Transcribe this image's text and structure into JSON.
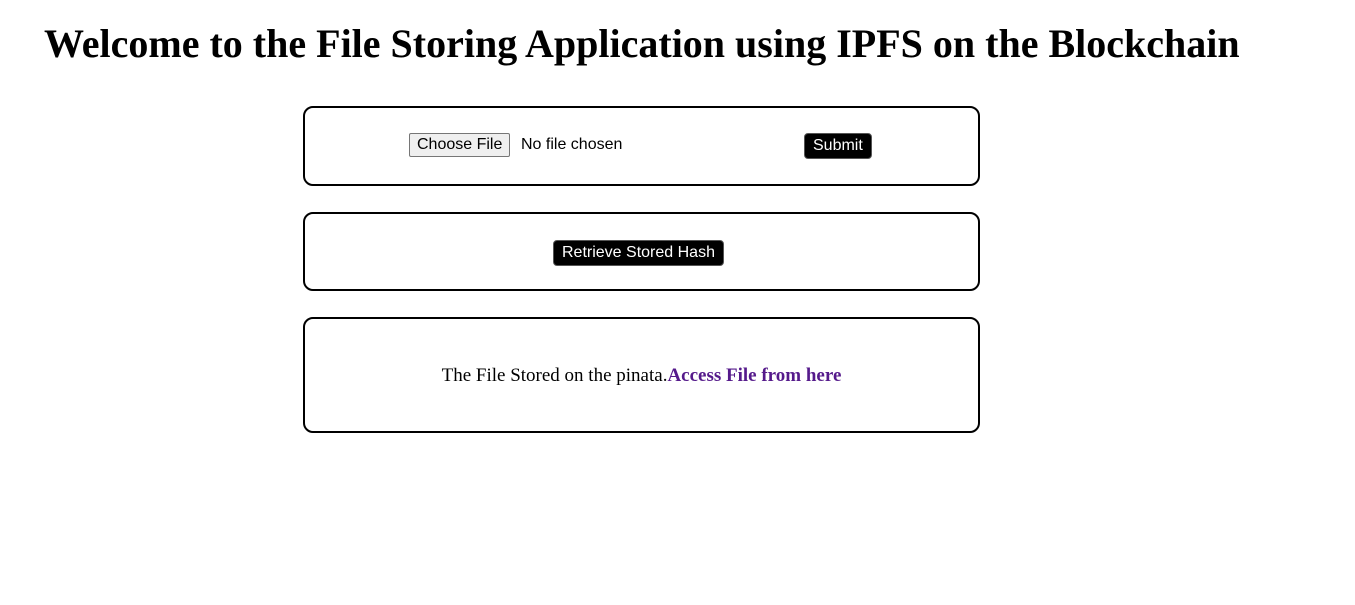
{
  "heading": "Welcome to the File Storing Application using IPFS on the Blockchain",
  "upload": {
    "choose_file_label": "Choose File",
    "file_status": "No file chosen",
    "submit_label": "Submit"
  },
  "retrieve": {
    "button_label": "Retrieve Stored Hash"
  },
  "result": {
    "message": "The File Stored on the pinata.",
    "link_text": "Access File from here",
    "link_color": "#551a8b"
  }
}
